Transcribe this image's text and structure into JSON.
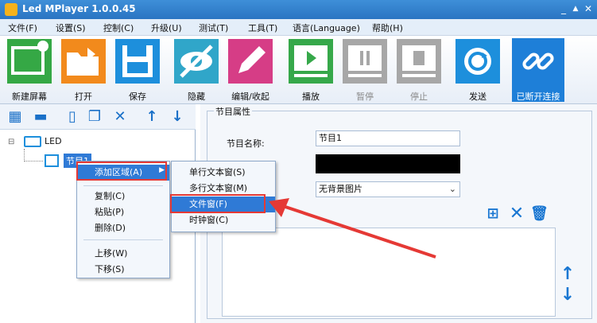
{
  "window": {
    "title": "Led MPlayer 1.0.0.45",
    "min_btn": "_",
    "max_btn": "▲",
    "close_btn": "✕"
  },
  "menu": [
    "文件(F)",
    "设置(S)",
    "控制(C)",
    "升级(U)",
    "测试(T)",
    "工具(T)",
    "语言(Language)",
    "帮助(H)"
  ],
  "toolbar": {
    "new_screen": "新建屏幕",
    "open": "打开",
    "save": "保存",
    "hide": "隐藏",
    "edit_collapse": "编辑/收起",
    "play": "播放",
    "pause": "暂停",
    "stop": "停止",
    "send": "发送",
    "disconnected": "已断开连接"
  },
  "tree": {
    "root": "LED",
    "node": "节目1"
  },
  "context_menu": {
    "add_area": "添加区域(A)",
    "copy": "复制(C)",
    "paste": "粘贴(P)",
    "delete": "删除(D)",
    "move_up": "上移(W)",
    "move_down": "下移(S)"
  },
  "submenu": {
    "single_line_text": "单行文本窗(S)",
    "multi_line_text": "多行文本窗(M)",
    "file_window": "文件窗(F)",
    "clock_window": "时钟窗(C)"
  },
  "properties": {
    "group_title": "节目属性",
    "name_label": "节目名称:",
    "name_value": "节目1",
    "bg_select": "无背景图片"
  },
  "colors": {
    "accent": "#1e7fd8",
    "highlight_red": "#e53935"
  }
}
